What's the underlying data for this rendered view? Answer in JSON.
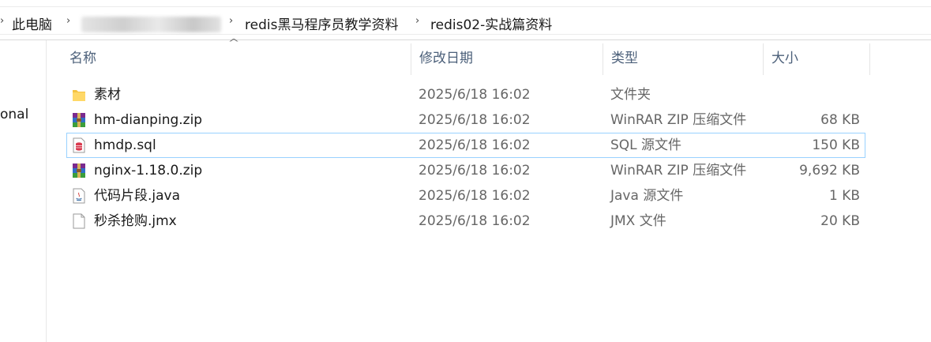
{
  "breadcrumb": {
    "root": "此电脑",
    "folder1": "redis黑马程序员教学资料",
    "folder2": "redis02-实战篇资料"
  },
  "navpane": {
    "partial_item": "onal"
  },
  "columns": {
    "name": "名称",
    "modified": "修改日期",
    "type": "类型",
    "size": "大小"
  },
  "files": [
    {
      "name": "素材",
      "modified": "2025/6/18 16:02",
      "type": "文件夹",
      "size": "",
      "icon": "folder-icon"
    },
    {
      "name": "hm-dianping.zip",
      "modified": "2025/6/18 16:02",
      "type": "WinRAR ZIP 压缩文件",
      "size": "68 KB",
      "icon": "winrar-archive-icon"
    },
    {
      "name": "hmdp.sql",
      "modified": "2025/6/18 16:02",
      "type": "SQL 源文件",
      "size": "150 KB",
      "icon": "sql-file-icon"
    },
    {
      "name": "nginx-1.18.0.zip",
      "modified": "2025/6/18 16:02",
      "type": "WinRAR ZIP 压缩文件",
      "size": "9,692 KB",
      "icon": "winrar-archive-icon"
    },
    {
      "name": "代码片段.java",
      "modified": "2025/6/18 16:02",
      "type": "Java 源文件",
      "size": "1 KB",
      "icon": "java-file-icon"
    },
    {
      "name": "秒杀抢购.jmx",
      "modified": "2025/6/18 16:02",
      "type": "JMX 文件",
      "size": "20 KB",
      "icon": "blank-file-icon"
    }
  ],
  "colors": {
    "selection_border": "#99d1ff",
    "header_text": "#4c607a",
    "folder": "#f5c342"
  }
}
